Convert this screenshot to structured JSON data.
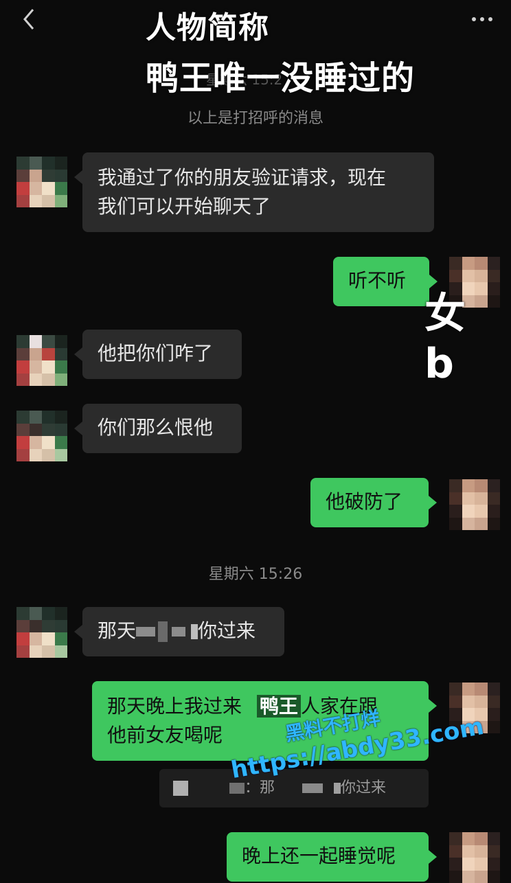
{
  "overlay": {
    "caption_line1": "人物简称",
    "caption_line2": "鸭王唯一没睡过的",
    "side_text": "女 b",
    "inline_label": "鸭王",
    "timestamp_behind": "星期六 15:2"
  },
  "system": {
    "greeting_note": "以上是打招呼的消息",
    "timestamp": "星期六 15:26"
  },
  "messages": [
    {
      "side": "received",
      "lines": [
        "我通过了你的朋友验证请求，现在",
        "我们可以开始聊天了"
      ]
    },
    {
      "side": "sent",
      "text": "听不听"
    },
    {
      "side": "received",
      "text": "他把你们咋了"
    },
    {
      "side": "received",
      "text": "你们那么恨他"
    },
    {
      "side": "sent",
      "text": "他破防了"
    },
    {
      "side": "received",
      "text_before": "那天",
      "text_after": "你过来"
    },
    {
      "side": "sent",
      "lines": [
        "那天晚上我过来",
        "人家在跟",
        "他前女友喝呢"
      ]
    },
    {
      "side": "sent",
      "text": "晚上还一起睡觉呢"
    }
  ],
  "quote": {
    "text_before": "：那",
    "text_after": "你过来"
  },
  "watermark": {
    "line1": "黑料不打烊",
    "line2": "https://abdy33.com"
  },
  "colors": {
    "background": "#0b0b0b",
    "received_bubble": "#2b2b2b",
    "sent_bubble": "#3fc75f",
    "watermark": "#2fb6ff"
  },
  "icons": {
    "back": "chevron-left-icon",
    "more": "more-dots-icon"
  }
}
